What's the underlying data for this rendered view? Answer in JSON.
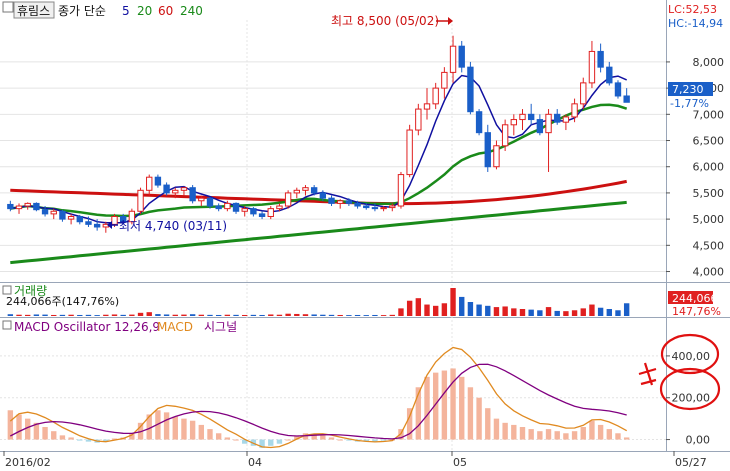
{
  "header": {
    "stock_name": "휴림스",
    "ma_label": "종가 단순",
    "ma_periods": [
      "5",
      "20",
      "60",
      "240"
    ],
    "ma_colors": [
      "#1010a0",
      "#1a8a1a",
      "#cc1010",
      "#1a8a1a"
    ]
  },
  "price_pane": {
    "y_ticks": [
      "8,000",
      "7,500",
      "7,000",
      "6,500",
      "6,000",
      "5,500",
      "5,000",
      "4,500",
      "4,000"
    ],
    "lc": "LC:52,53",
    "hc": "HC:-14,94",
    "current_price": "7,230",
    "change_pct": "-1,77%",
    "high_annotation": "최고 8,500 (05/02)",
    "low_annotation": "최저 4,740 (03/11)"
  },
  "volume_pane": {
    "title": "거래량",
    "summary": "244,066주(147,76%)",
    "current_value": "244,066",
    "current_pct": "147,76%"
  },
  "macd_pane": {
    "osc_label": "MACD Oscillator 12,26,9",
    "macd_label": "MACD",
    "signal_label": "시그널",
    "y_ticks": [
      "400,00",
      "200,00",
      "0,00"
    ]
  },
  "x_axis": {
    "labels": [
      "2016/02",
      "04",
      "05",
      "05/27"
    ]
  },
  "colors": {
    "up": "#e02020",
    "down": "#1a5fc8",
    "osc_bar": "#f4b49c",
    "macd_line": "#e08a20",
    "signal_line": "#800080",
    "annotation_red": "#e02020",
    "annotation_blue": "#1010a0"
  },
  "chart_data": {
    "type": "candlestick",
    "candles": [
      [
        5280,
        5350,
        5150,
        5200
      ],
      [
        5200,
        5300,
        5100,
        5250
      ],
      [
        5250,
        5320,
        5180,
        5300
      ],
      [
        5300,
        5320,
        5150,
        5180
      ],
      [
        5180,
        5250,
        5050,
        5100
      ],
      [
        5100,
        5200,
        5000,
        5150
      ],
      [
        5150,
        5180,
        4950,
        5000
      ],
      [
        5000,
        5100,
        4900,
        5050
      ],
      [
        5050,
        5080,
        4900,
        4950
      ],
      [
        4950,
        5050,
        4850,
        4900
      ],
      [
        4900,
        5000,
        4780,
        4850
      ],
      [
        4850,
        4950,
        4740,
        4900
      ],
      [
        4900,
        5100,
        4850,
        5050
      ],
      [
        5050,
        5100,
        4900,
        4950
      ],
      [
        4950,
        5200,
        4900,
        5150
      ],
      [
        5150,
        5600,
        5100,
        5550
      ],
      [
        5550,
        5850,
        5450,
        5800
      ],
      [
        5800,
        5850,
        5600,
        5650
      ],
      [
        5650,
        5700,
        5450,
        5500
      ],
      [
        5500,
        5600,
        5400,
        5550
      ],
      [
        5550,
        5620,
        5450,
        5600
      ],
      [
        5600,
        5650,
        5300,
        5350
      ],
      [
        5350,
        5450,
        5250,
        5400
      ],
      [
        5400,
        5420,
        5200,
        5250
      ],
      [
        5250,
        5300,
        5150,
        5200
      ],
      [
        5200,
        5350,
        5150,
        5300
      ],
      [
        5300,
        5320,
        5100,
        5150
      ],
      [
        5150,
        5250,
        5050,
        5200
      ],
      [
        5200,
        5230,
        5050,
        5100
      ],
      [
        5100,
        5150,
        5000,
        5050
      ],
      [
        5050,
        5250,
        5000,
        5200
      ],
      [
        5200,
        5300,
        5150,
        5250
      ],
      [
        5250,
        5550,
        5200,
        5500
      ],
      [
        5500,
        5600,
        5400,
        5550
      ],
      [
        5550,
        5650,
        5450,
        5600
      ],
      [
        5600,
        5650,
        5450,
        5500
      ],
      [
        5500,
        5550,
        5350,
        5400
      ],
      [
        5400,
        5450,
        5250,
        5300
      ],
      [
        5300,
        5380,
        5200,
        5350
      ],
      [
        5350,
        5400,
        5250,
        5300
      ],
      [
        5300,
        5350,
        5200,
        5250
      ],
      [
        5250,
        5300,
        5180,
        5220
      ],
      [
        5220,
        5300,
        5150,
        5200
      ],
      [
        5200,
        5250,
        5150,
        5220
      ],
      [
        5220,
        5300,
        5150,
        5250
      ],
      [
        5250,
        5900,
        5200,
        5850
      ],
      [
        5850,
        6800,
        5800,
        6700
      ],
      [
        6700,
        7200,
        6600,
        7100
      ],
      [
        7100,
        7500,
        6900,
        7200
      ],
      [
        7200,
        7600,
        7100,
        7500
      ],
      [
        7500,
        7900,
        7300,
        7800
      ],
      [
        7800,
        8500,
        7600,
        8300
      ],
      [
        8300,
        8400,
        7800,
        7900
      ],
      [
        7900,
        8000,
        7000,
        7050
      ],
      [
        7050,
        7100,
        6600,
        6650
      ],
      [
        6650,
        6800,
        5900,
        6000
      ],
      [
        6000,
        6500,
        5950,
        6400
      ],
      [
        6400,
        6900,
        6300,
        6800
      ],
      [
        6800,
        7000,
        6600,
        6900
      ],
      [
        6900,
        7100,
        6700,
        7000
      ],
      [
        7000,
        7200,
        6800,
        6900
      ],
      [
        6900,
        7000,
        6600,
        6650
      ],
      [
        6650,
        7100,
        5900,
        7000
      ],
      [
        7000,
        7100,
        6800,
        6850
      ],
      [
        6850,
        7000,
        6700,
        6950
      ],
      [
        6950,
        7300,
        6850,
        7200
      ],
      [
        7200,
        7700,
        7100,
        7600
      ],
      [
        7600,
        8400,
        7500,
        8200
      ],
      [
        8200,
        8350,
        7800,
        7900
      ],
      [
        7900,
        8000,
        7550,
        7600
      ],
      [
        7600,
        7650,
        7300,
        7350
      ],
      [
        7350,
        7500,
        7250,
        7230
      ]
    ],
    "volume": [
      14,
      10,
      9,
      12,
      11,
      8,
      9,
      10,
      8,
      9,
      7,
      10,
      12,
      9,
      11,
      25,
      30,
      15,
      12,
      10,
      11,
      14,
      10,
      9,
      8,
      10,
      9,
      8,
      9,
      8,
      12,
      10,
      18,
      16,
      14,
      12,
      10,
      9,
      8,
      7,
      8,
      7,
      8,
      7,
      9,
      60,
      120,
      140,
      90,
      80,
      100,
      220,
      150,
      110,
      90,
      80,
      70,
      75,
      60,
      55,
      50,
      45,
      70,
      40,
      38,
      45,
      60,
      90,
      65,
      55,
      45,
      100
    ],
    "macd_osc": [
      140,
      120,
      100,
      80,
      60,
      40,
      20,
      10,
      -5,
      -10,
      -15,
      -10,
      5,
      10,
      30,
      80,
      120,
      140,
      130,
      110,
      100,
      90,
      70,
      50,
      30,
      10,
      0,
      -20,
      -30,
      -40,
      -30,
      -20,
      0,
      20,
      30,
      25,
      20,
      10,
      0,
      -5,
      -10,
      -10,
      -10,
      -5,
      0,
      50,
      150,
      250,
      300,
      320,
      330,
      340,
      300,
      250,
      200,
      150,
      100,
      80,
      70,
      60,
      50,
      40,
      50,
      40,
      30,
      40,
      60,
      90,
      70,
      50,
      30,
      10
    ],
    "x_labels": [
      "2016/02",
      "04",
      "05",
      "05/27"
    ],
    "price_ylim": [
      3800,
      8800
    ],
    "macd_ylim": [
      -50,
      500
    ]
  }
}
